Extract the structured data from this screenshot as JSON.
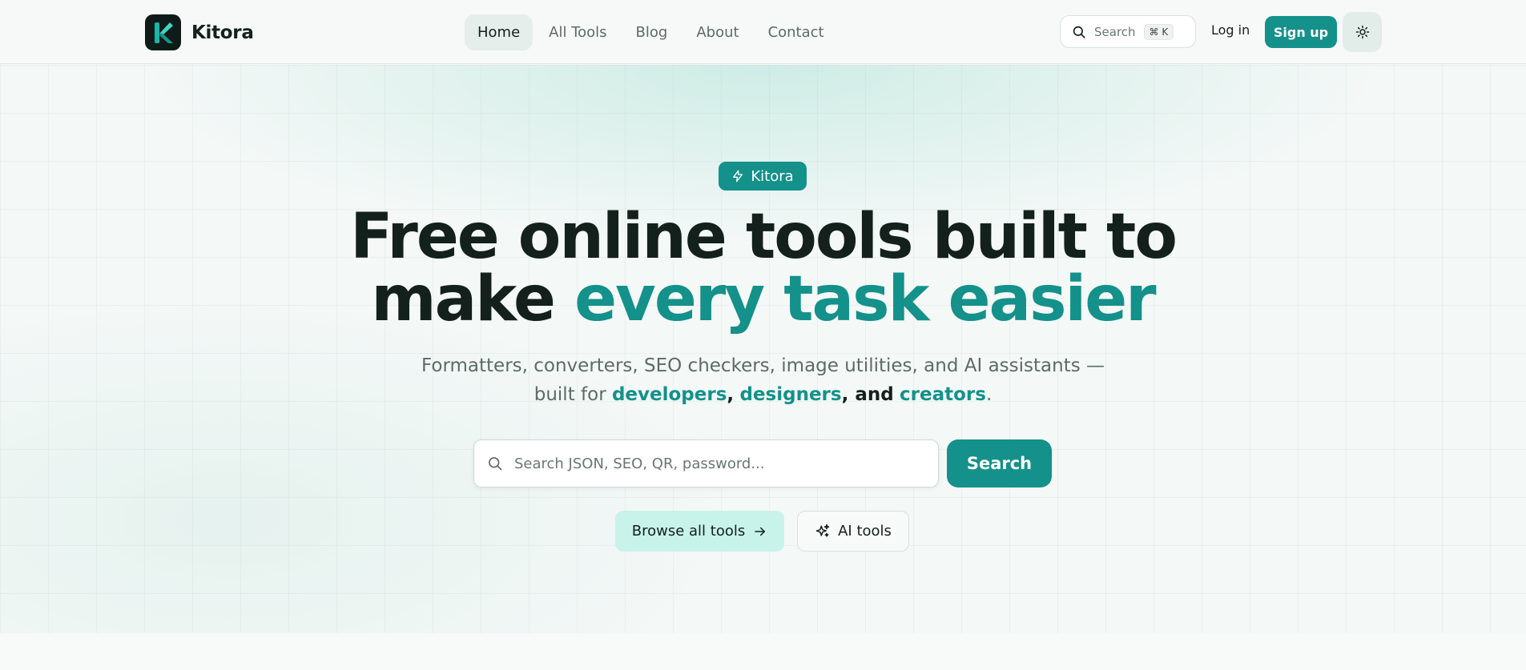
{
  "header": {
    "brand": "Kitora",
    "nav": [
      {
        "label": "Home",
        "active": true
      },
      {
        "label": "All Tools",
        "active": false
      },
      {
        "label": "Blog",
        "active": false
      },
      {
        "label": "About",
        "active": false
      },
      {
        "label": "Contact",
        "active": false
      }
    ],
    "search_label": "Search",
    "search_shortcut": "⌘ K",
    "login_label": "Log in",
    "signup_label": "Sign up",
    "theme_icon": "sun-icon"
  },
  "hero": {
    "badge": "Kitora",
    "headline_line1": "Free online tools built to",
    "headline_line2_plain": "make ",
    "headline_line2_accent": "every task easier",
    "subtitle_line1": "Formatters, converters, SEO checkers, image utilities, and AI assistants —",
    "subtitle_prefix": "built for ",
    "audience_1": "developers",
    "comma_1": ",",
    "audience_2": "designers",
    "and_text": ", and",
    "audience_3": "creators",
    "period": ".",
    "search_placeholder": "Search JSON, SEO, QR, password...",
    "search_button": "Search",
    "browse_button": "Browse all tools",
    "ai_button": "AI tools"
  },
  "colors": {
    "accent": "#13918a",
    "dark": "#14201c",
    "muted": "#5d6b67",
    "mint": "#c7f3ea"
  }
}
